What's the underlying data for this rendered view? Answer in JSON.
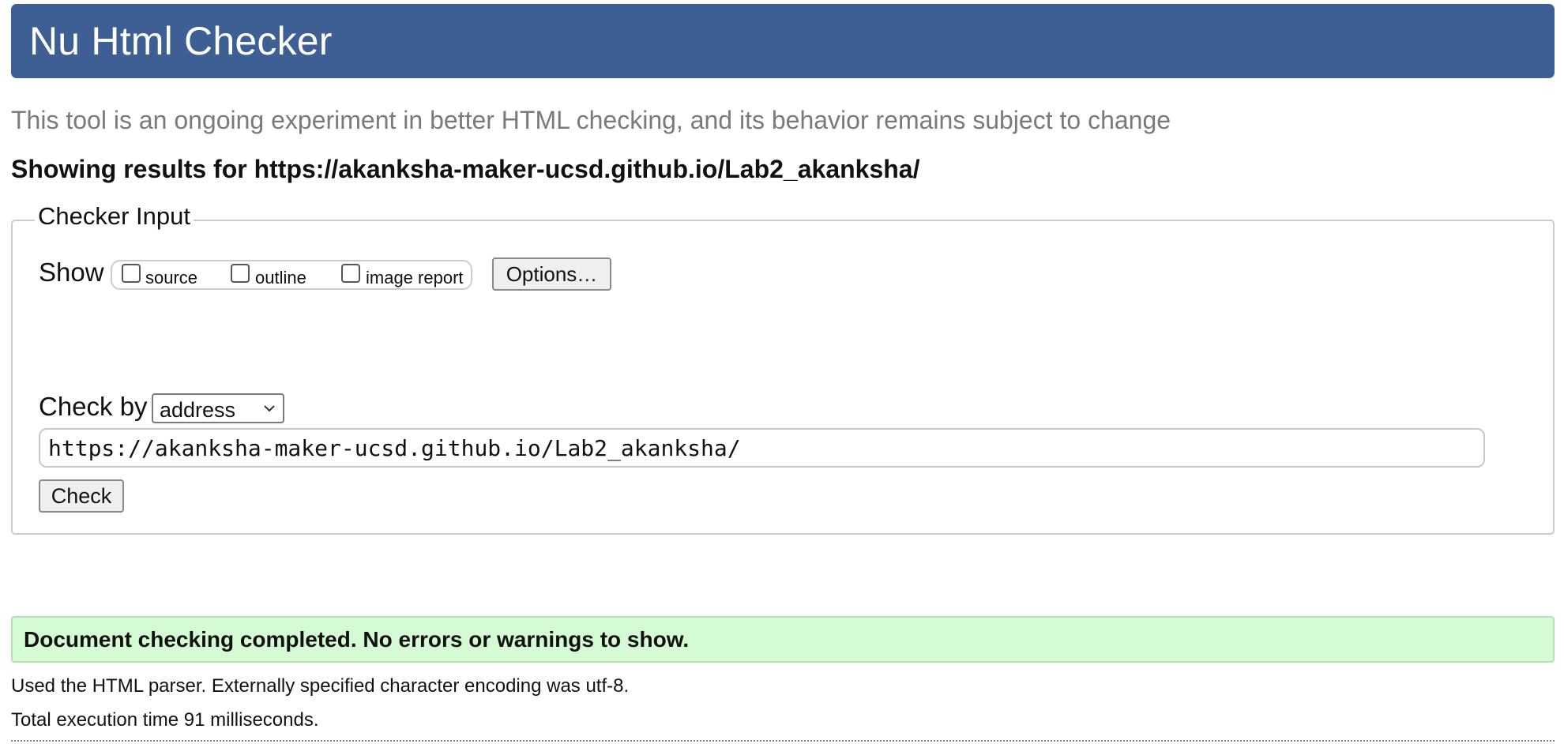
{
  "header": {
    "title": "Nu Html Checker"
  },
  "tagline": "This tool is an ongoing experiment in better HTML checking, and its behavior remains subject to change",
  "results_heading": "Showing results for https://akanksha-maker-ucsd.github.io/Lab2_akanksha/",
  "checker_input": {
    "legend": "Checker Input",
    "show_label": "Show",
    "show_options": [
      {
        "label": "source",
        "checked": false
      },
      {
        "label": "outline",
        "checked": false
      },
      {
        "label": "image report",
        "checked": false
      }
    ],
    "options_button": "Options…",
    "check_by_label": "Check by",
    "check_by_value": "address",
    "url_value": "https://akanksha-maker-ucsd.github.io/Lab2_akanksha/",
    "check_button": "Check"
  },
  "result": {
    "message": "Document checking completed. No errors or warnings to show.",
    "parser_note": "Used the HTML parser. Externally specified character encoding was utf-8.",
    "execution_time": "Total execution time 91 milliseconds."
  },
  "colors": {
    "header_bg": "#3e5f94",
    "success_bg": "#d5fbd5",
    "tagline_text": "#7a7a7a"
  }
}
